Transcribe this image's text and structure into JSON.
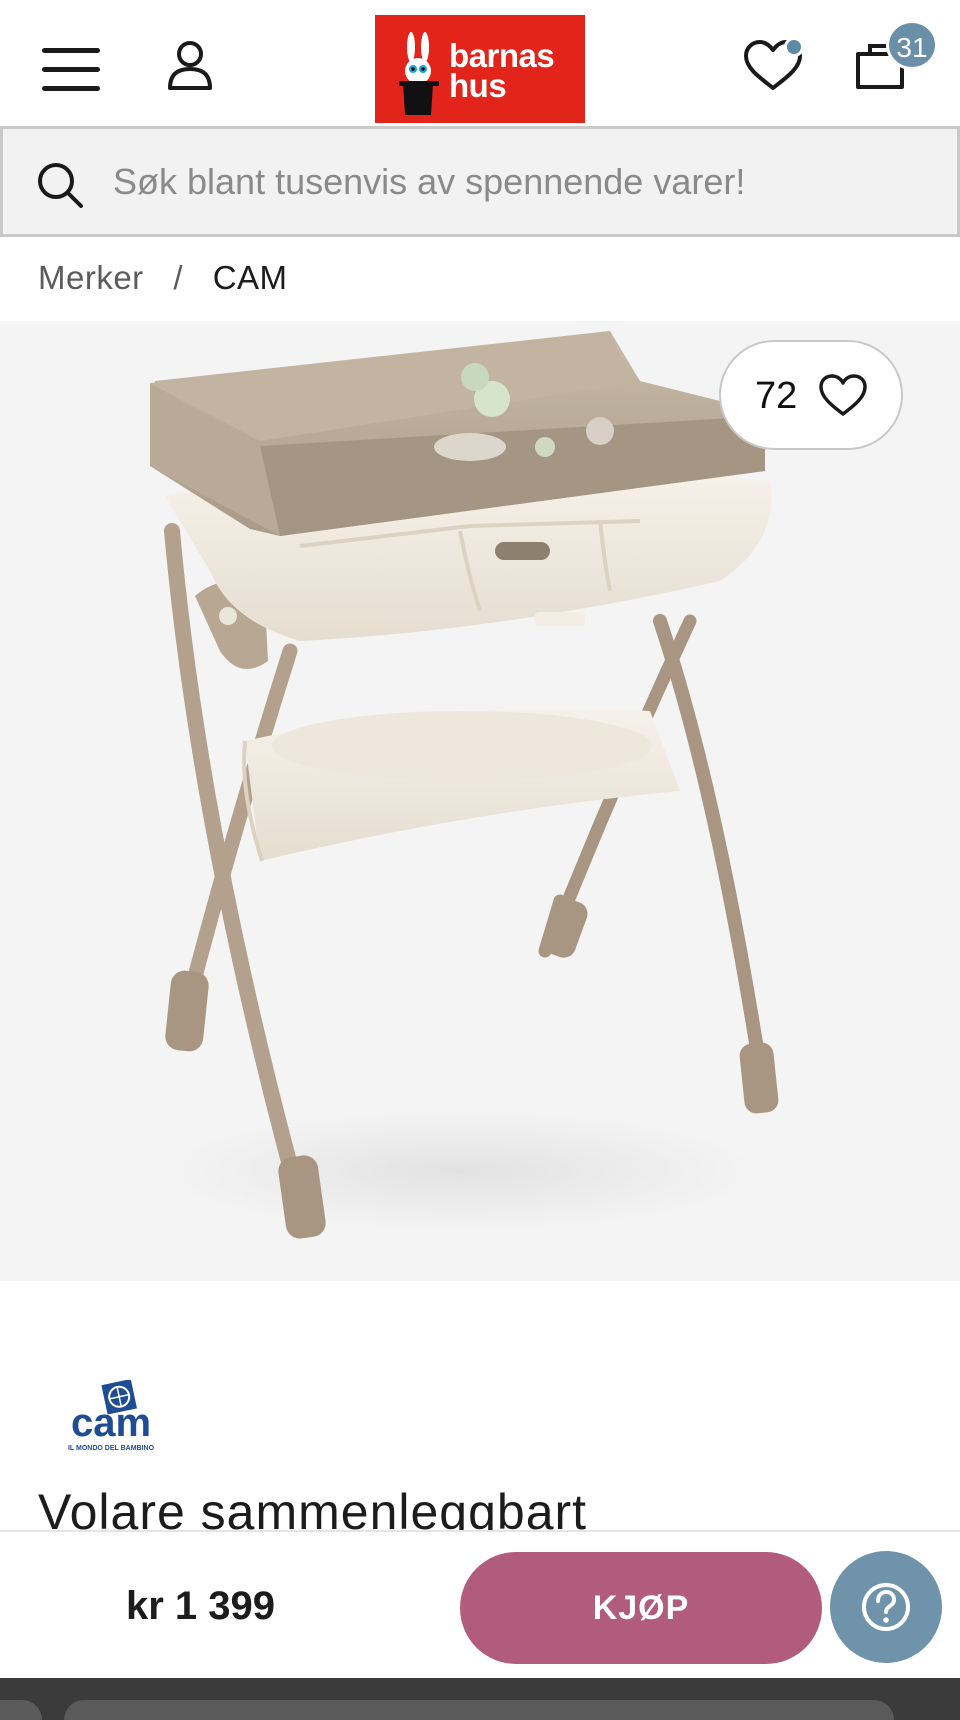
{
  "header": {
    "menu_icon": "hamburger-menu-icon",
    "account_icon": "user-icon",
    "logo": {
      "line1": "barnas",
      "line2": "hus",
      "color": "#e2241b"
    },
    "wishlist_icon": "heart-icon",
    "cart_icon": "bag-icon",
    "cart_count": "31"
  },
  "search": {
    "placeholder": "Søk blant tusenvis av spennende varer!",
    "icon": "search-icon"
  },
  "breadcrumb": {
    "items": [
      "Merker",
      "CAM"
    ],
    "separator": "/"
  },
  "product": {
    "image_alt": "Volare sammenleggbart stellebord",
    "likes": "72",
    "brand_logo": {
      "name": "cam",
      "tagline": "IL MONDO DEL BAMBINO"
    },
    "title": "Volare sammenleggbart"
  },
  "buybar": {
    "price": "kr 1 399",
    "buy_label": "KJØP",
    "help_icon": "question-mark-icon",
    "buy_color": "#b15c7a",
    "help_color": "#6f93ab"
  }
}
